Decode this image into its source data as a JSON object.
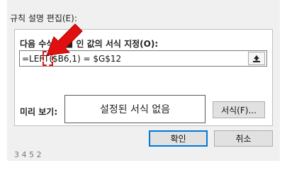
{
  "window": {
    "cut_top_left": "",
    "edit_rule_description": "규칙 설명 편집(E):"
  },
  "rule": {
    "label": "다음 수식 ■■ 인 값의 서식 지정(O):",
    "formula_value": "=LEFT($B6,1) = $G$12"
  },
  "preview": {
    "label": "미리 보기:",
    "text": "설정된 서식 없음",
    "format_button": "서식(F)..."
  },
  "buttons": {
    "ok": "확인",
    "cancel": "취소"
  },
  "behind": {
    "cut_bottom_text": "3 4 5 2"
  },
  "colors": {
    "annotation_red": "#e01010",
    "dialog_bg": "#f0f0f0",
    "ok_border": "#0078d7"
  },
  "icons": {
    "collapse": "collapse-dialog-icon",
    "annotation": "red-arrow-icon"
  }
}
